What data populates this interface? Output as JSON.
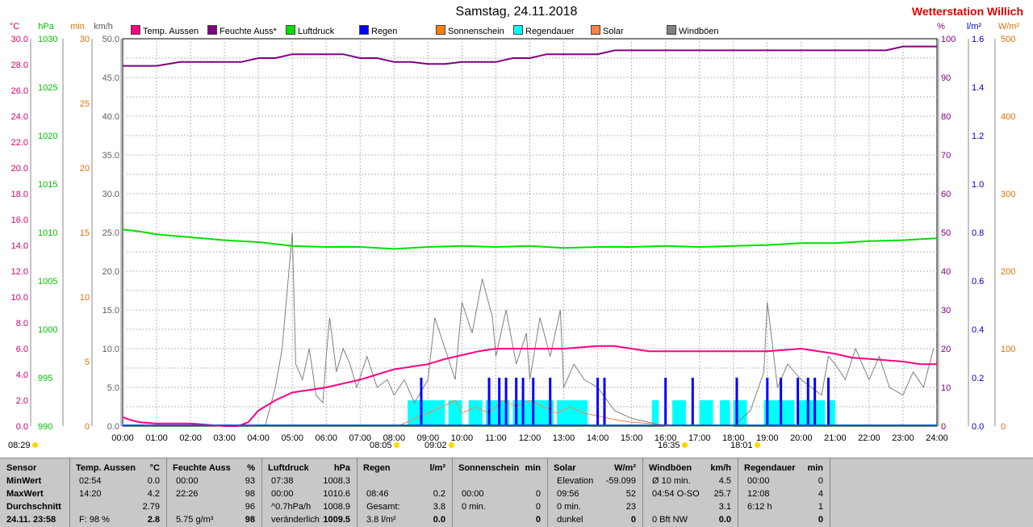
{
  "header": {
    "title": "Samstag, 24.11.2018",
    "station": "Wetterstation Willich"
  },
  "legend": [
    {
      "label": "Temp. Aussen",
      "color": "#ff0080"
    },
    {
      "label": "Feuchte Auss*",
      "color": "#800080"
    },
    {
      "label": "Luftdruck",
      "color": "#00e000"
    },
    {
      "label": "Regen",
      "color": "#0000ff"
    },
    {
      "label": "Sonnenschein",
      "color": "#ff8000"
    },
    {
      "label": "Regendauer",
      "color": "#00ffff"
    },
    {
      "label": "Solar",
      "color": "#ff8040"
    },
    {
      "label": "Windböen",
      "color": "#808080"
    }
  ],
  "axes": {
    "left_units": [
      "°C",
      "hPa",
      "min",
      "km/h"
    ],
    "right_units": [
      "%",
      "l/m²",
      "W/m²"
    ],
    "temp_ticks": [
      "30.0",
      "28.0",
      "26.0",
      "24.0",
      "22.0",
      "20.0",
      "18.0",
      "16.0",
      "14.0",
      "12.0",
      "10.0",
      "8.0",
      "6.0",
      "4.0",
      "2.0",
      "0.0"
    ],
    "pressure_ticks": [
      "1030",
      "1025",
      "1020",
      "1015",
      "1010",
      "1005",
      "1000",
      "995",
      "990"
    ],
    "minutes_ticks": [
      "30",
      "25",
      "20",
      "15",
      "10",
      "5",
      "0"
    ],
    "wind_ticks": [
      "50.0",
      "45.0",
      "40.0",
      "35.0",
      "30.0",
      "25.0",
      "20.0",
      "15.0",
      "10.0",
      "5.0",
      "0.0"
    ],
    "humidity_ticks": [
      "100",
      "90",
      "80",
      "70",
      "60",
      "50",
      "40",
      "30",
      "20",
      "10",
      "0"
    ],
    "rain_ticks": [
      "1.6",
      "1.4",
      "1.2",
      "1.0",
      "0.8",
      "0.6",
      "0.4",
      "0.2",
      "0.0"
    ],
    "solar_ticks": [
      "500",
      "400",
      "300",
      "200",
      "100",
      "0"
    ],
    "time_ticks": [
      "00:00",
      "01:00",
      "02:00",
      "03:00",
      "04:00",
      "05:00",
      "06:00",
      "07:00",
      "08:00",
      "09:00",
      "10:00",
      "11:00",
      "12:00",
      "13:00",
      "14:00",
      "15:00",
      "16:00",
      "17:00",
      "18:00",
      "19:00",
      "20:00",
      "21:00",
      "22:00",
      "23:00",
      "24:00"
    ]
  },
  "sun_marks": [
    {
      "label": "08:29",
      "kind": "sunrise"
    },
    {
      "label": "08:05",
      "kind": "dawn"
    },
    {
      "label": "09:02",
      "kind": "sunrise"
    },
    {
      "label": "16:35",
      "kind": "sunset"
    },
    {
      "label": "18:01",
      "kind": "dusk"
    }
  ],
  "chart_data": {
    "type": "line",
    "x_range": [
      "00:00",
      "24:00"
    ],
    "series": [
      {
        "name": "Temp. Aussen",
        "unit": "°C",
        "ylim": [
          0,
          30
        ],
        "x": [
          0,
          0.2,
          0.5,
          1,
          1.5,
          2,
          2.5,
          3,
          3.4,
          3.7,
          4,
          4.5,
          5,
          5.5,
          6,
          6.5,
          7,
          7.5,
          8,
          8.5,
          9,
          9.5,
          10,
          10.5,
          11,
          11.5,
          12,
          13,
          14,
          14.5,
          15,
          15.5,
          16,
          17,
          18,
          19,
          20,
          20.5,
          21,
          21.5,
          22,
          22.5,
          23,
          23.5,
          24
        ],
        "y": [
          0.7,
          0.5,
          0.3,
          0.2,
          0.2,
          0.2,
          0.1,
          0.0,
          0.0,
          0.3,
          1.2,
          2.0,
          2.6,
          2.8,
          3.0,
          3.3,
          3.6,
          4.0,
          4.4,
          4.6,
          4.8,
          5.2,
          5.5,
          5.8,
          6.0,
          6.0,
          6.0,
          6.0,
          6.2,
          6.2,
          6.0,
          5.8,
          5.8,
          5.8,
          5.8,
          5.8,
          6.0,
          5.8,
          5.6,
          5.3,
          5.2,
          5.1,
          5.0,
          4.8,
          4.8
        ]
      },
      {
        "name": "Feuchte Auss*",
        "unit": "%",
        "ylim": [
          0,
          100
        ],
        "x": [
          0,
          1,
          1.7,
          2,
          3,
          3.5,
          4,
          4.5,
          5,
          6,
          6.5,
          7,
          7.5,
          8,
          8.5,
          9,
          9.5,
          10,
          11,
          11.5,
          12,
          12.5,
          13,
          14,
          14.5,
          15,
          16,
          17,
          18,
          19,
          20,
          21,
          22,
          22.5,
          23,
          23.5,
          24
        ],
        "y": [
          93,
          93,
          94,
          94,
          94,
          94,
          95,
          95,
          96,
          96,
          96,
          95,
          95,
          94,
          94,
          93.5,
          93.5,
          94,
          94,
          95,
          95,
          96,
          96,
          96,
          97,
          97,
          97,
          97,
          97,
          97,
          97,
          97,
          97,
          97,
          98,
          98,
          98
        ]
      },
      {
        "name": "Luftdruck",
        "unit": "hPa",
        "ylim": [
          990,
          1030
        ],
        "x": [
          0,
          0.5,
          1,
          2,
          3,
          4,
          5,
          6,
          7,
          8,
          9,
          10,
          11,
          12,
          13,
          14,
          15,
          16,
          17,
          18,
          19,
          20,
          21,
          22,
          23,
          24
        ],
        "y": [
          1010.3,
          1010.1,
          1009.8,
          1009.5,
          1009.2,
          1009.0,
          1008.6,
          1008.5,
          1008.5,
          1008.3,
          1008.5,
          1008.6,
          1008.5,
          1008.6,
          1008.4,
          1008.5,
          1008.5,
          1008.6,
          1008.5,
          1008.6,
          1008.7,
          1008.9,
          1008.9,
          1009.1,
          1009.2,
          1009.4
        ]
      },
      {
        "name": "Windböen",
        "unit": "km/h",
        "ylim": [
          0,
          50
        ],
        "x": [
          4.2,
          4.5,
          4.7,
          4.9,
          5.0,
          5.1,
          5.3,
          5.5,
          5.7,
          5.9,
          6.0,
          6.1,
          6.3,
          6.5,
          6.7,
          6.9,
          7.2,
          7.5,
          7.8,
          8.0,
          8.3,
          8.6,
          9.0,
          9.2,
          9.5,
          9.8,
          10.0,
          10.3,
          10.6,
          10.9,
          11.0,
          11.3,
          11.6,
          11.9,
          12.0,
          12.3,
          12.6,
          12.9,
          13.0,
          13.3,
          13.6,
          14.0,
          14.5,
          15.0,
          16.0,
          17.0,
          18.0,
          18.5,
          18.9,
          19.0,
          19.3,
          19.6,
          20.0,
          20.3,
          20.6,
          20.8,
          21.0,
          21.3,
          21.6,
          22.0,
          22.3,
          22.6,
          23.0,
          23.3,
          23.6,
          23.9
        ],
        "y": [
          0,
          5,
          10,
          20,
          25,
          8,
          6,
          10,
          4,
          3,
          9,
          14,
          7,
          10,
          8,
          5,
          9,
          5,
          6,
          4,
          6,
          3,
          6,
          14,
          10,
          6,
          16,
          12,
          19,
          14,
          9,
          15,
          8,
          12,
          6,
          14,
          9,
          15,
          5,
          8,
          6,
          5,
          2,
          1,
          0,
          0,
          0,
          2,
          7,
          16,
          5,
          8,
          6,
          5,
          4,
          9,
          8,
          6,
          10,
          6,
          9,
          5,
          4,
          7,
          5,
          10
        ]
      },
      {
        "name": "Sonnenschein",
        "unit": "min",
        "ylim": [
          0,
          30
        ],
        "x": [
          8.1,
          9.0,
          9.4,
          9.8,
          10.0,
          10.4,
          10.8,
          11.2,
          11.6,
          12.0,
          12.4,
          12.8,
          13.2,
          13.6,
          14.0,
          14.5,
          15.0,
          15.5,
          16.0,
          16.5
        ],
        "y": [
          0,
          1,
          1.5,
          2,
          1,
          1.5,
          1,
          2,
          1.5,
          2,
          1.5,
          1,
          1.5,
          1,
          0.8,
          0.5,
          0.3,
          0.2,
          0.1,
          0
        ]
      },
      {
        "name": "Regen",
        "unit": "l/m²",
        "ylim": [
          0,
          1.6
        ],
        "x": [
          8.8,
          10.8,
          11.1,
          11.3,
          11.6,
          11.8,
          12.1,
          12.6,
          14.0,
          14.2,
          16.0,
          16.8,
          18.1,
          19.0,
          19.4,
          19.9,
          20.2,
          20.4,
          20.8
        ],
        "y": [
          0.2,
          0.2,
          0.2,
          0.2,
          0.2,
          0.2,
          0.2,
          0.2,
          0.2,
          0.2,
          0.2,
          0.2,
          0.2,
          0.2,
          0.2,
          0.2,
          0.2,
          0.2,
          0.2
        ]
      },
      {
        "name": "Regendauer",
        "unit": "min",
        "ylim": [
          0,
          30
        ],
        "x": [
          8.4,
          9.5,
          9.9,
          10.6,
          11.5,
          11.9,
          12.4,
          12.8,
          13.2,
          13.7,
          15.7,
          16.2,
          16.6,
          17.0,
          17.4,
          17.8,
          18.2,
          18.6,
          19.0,
          19.4,
          19.8,
          20.2,
          20.6,
          21.0
        ],
        "y": [
          2,
          2,
          2,
          2,
          2,
          2,
          2,
          2,
          2,
          2,
          2,
          2,
          2,
          2,
          2,
          2,
          2,
          2,
          2,
          2,
          2,
          2,
          2,
          2
        ]
      }
    ],
    "rain_duration_spans": [
      [
        8.4,
        9.5
      ],
      [
        9.6,
        10.0
      ],
      [
        10.2,
        10.6
      ],
      [
        10.7,
        11.4
      ],
      [
        11.5,
        12.7
      ],
      [
        12.8,
        13.7
      ],
      [
        15.6,
        15.8
      ],
      [
        16.2,
        16.6
      ],
      [
        17.0,
        17.4
      ],
      [
        17.6,
        17.9
      ],
      [
        18.0,
        18.4
      ],
      [
        18.9,
        19.8
      ],
      [
        19.9,
        20.7
      ],
      [
        20.8,
        21.0
      ]
    ]
  },
  "table": {
    "row_labels": [
      "Sensor",
      "MinWert",
      "MaxWert",
      "Durchschnitt",
      "24.11. 23:58"
    ],
    "columns": [
      {
        "title": "Temp. Aussen",
        "unit": "°C",
        "rows": [
          [
            "02:54",
            "0.0"
          ],
          [
            "14:20",
            "4.2"
          ],
          [
            "",
            "2.79"
          ],
          [
            "F: 98 %",
            "2.8"
          ]
        ]
      },
      {
        "title": "Feuchte Auss",
        "unit": "%",
        "rows": [
          [
            "00:00",
            "93"
          ],
          [
            "22:26",
            "98"
          ],
          [
            "",
            "96"
          ],
          [
            "5.75 g/m³",
            "98"
          ]
        ]
      },
      {
        "title": "Luftdruck",
        "unit": "hPa",
        "rows": [
          [
            "07:38",
            "1008.3"
          ],
          [
            "00:00",
            "1010.6"
          ],
          [
            "^0.7hPa/h",
            "1008.9"
          ],
          [
            "veränderlich",
            "1009.5"
          ]
        ]
      },
      {
        "title": "Regen",
        "unit": "l/m²",
        "rows": [
          [
            "",
            ""
          ],
          [
            "08:46",
            "0.2"
          ],
          [
            "Gesamt:",
            "3.8"
          ],
          [
            "3.8 l/m²",
            "0.0"
          ]
        ]
      },
      {
        "title": "Sonnenschein",
        "unit": "min",
        "rows": [
          [
            "",
            ""
          ],
          [
            "00:00",
            "0"
          ],
          [
            "0 min.",
            "0"
          ],
          [
            "",
            "0"
          ]
        ]
      },
      {
        "title": "Solar",
        "unit": "W/m²",
        "rows": [
          [
            "Elevation",
            "-59.099"
          ],
          [
            "09:56",
            "52"
          ],
          [
            "0 min.",
            "23"
          ],
          [
            "dunkel",
            "0"
          ]
        ]
      },
      {
        "title": "Windböen",
        "unit": "km/h",
        "rows": [
          [
            "Ø 10 min.",
            "4.5"
          ],
          [
            "04:54   O-SO",
            "25.7"
          ],
          [
            "",
            "3.1"
          ],
          [
            "0 Bft NW",
            "0.0"
          ]
        ]
      },
      {
        "title": "Regendauer",
        "unit": "min",
        "rows": [
          [
            "00:00",
            "0"
          ],
          [
            "12:08",
            "4"
          ],
          [
            "6:12 h",
            "1"
          ],
          [
            "",
            "0"
          ]
        ]
      }
    ]
  }
}
